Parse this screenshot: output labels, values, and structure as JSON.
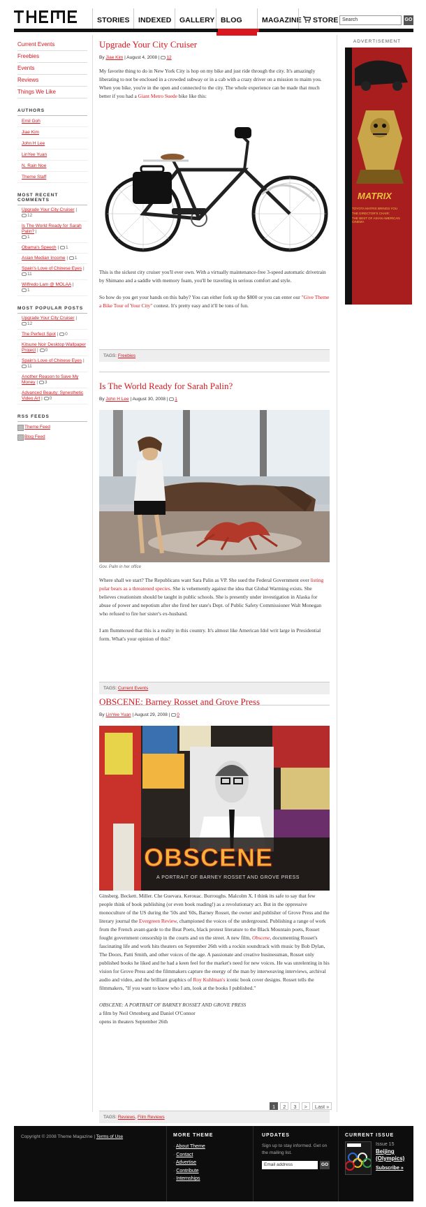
{
  "header": {
    "logo": "THEME",
    "nav": [
      {
        "label": "STORIES"
      },
      {
        "label": "INDEXED"
      },
      {
        "label": "GALLERY"
      },
      {
        "label": "BLOG"
      },
      {
        "label": "MAGAZINE"
      },
      {
        "label": "STORE"
      }
    ],
    "search_value": "Search",
    "go_label": "GO"
  },
  "sidebar": {
    "sections": [
      "Current Events",
      "Freebies",
      "Events",
      "Reviews",
      "Things We Like"
    ],
    "authors_heading": "AUTHORS",
    "authors": [
      "Emil Goh",
      "Jiae Kim",
      "John H Lee",
      "LinYee Yuan",
      "N. Rain Noe",
      "Theme Staff"
    ],
    "recent_heading": "MOST RECENT COMMENTS",
    "recent": [
      {
        "title": "Upgrade Your City Cruiser",
        "count": "12"
      },
      {
        "title": "Is The World Ready for Sarah Palin?",
        "count": "1"
      },
      {
        "title": "Obama's Speech",
        "count": "1"
      },
      {
        "title": "Asian Median Income",
        "count": "1"
      },
      {
        "title": "Spain's Love of Chinese Eyes",
        "count": "11"
      },
      {
        "title": "Wilfredo Lam @ MOLAA",
        "count": "1"
      }
    ],
    "popular_heading": "MOST POPULAR POSTS",
    "popular": [
      {
        "title": "Upgrade Your City Cruiser",
        "count": "12"
      },
      {
        "title": "The Perfect Spot",
        "count": "0"
      },
      {
        "title": "Kitsune Noir Desktop Wallpaper Project",
        "count": "0"
      },
      {
        "title": "Spain's Love of Chinese Eyes",
        "count": "11"
      },
      {
        "title": "Another Reason to Save My Money",
        "count": "3"
      },
      {
        "title": "Advanced Beauty: Synesthetic Video Art",
        "count": "0"
      }
    ],
    "rss_heading": "RSS FEEDS",
    "rss": [
      "Theme Feed",
      "Blog Feed"
    ]
  },
  "posts": [
    {
      "title": "Upgrade Your City Cruiser",
      "by": "By",
      "author": "Jiae Kim",
      "date": "August 4, 2008",
      "comments": "12",
      "p1a": "My favorite thing to do in New York City is hop on my bike and just ride through the city. It's amazingly liberating to not be enclosed in a crowded subway or in a cab with a crazy driver on a mission to maim you. When you bike, you're in the open and connected to the city. The whole experience can be made that much better if you had a",
      "p1link": "Giant Metro Suede",
      "p1b": "bike like this:",
      "p2": "This is the sickest city cruiser you'll ever own. With a virtually maintenance-free 3-speed automatic drivetrain by Shimano and a saddle with memory foam, you'll be traveling in serious comfort and style.",
      "p3a": "So how do you get your hands on this baby? You can either fork up the $800 or you can enter our",
      "p3link": "\"Give Theme a Bike Tour of Your City\"",
      "p3b": "contest. It's pretty easy and it'll be tons of fun.",
      "tags_label": "TAGS:",
      "tags": [
        "Freebies"
      ]
    },
    {
      "title": "Is The World Ready for Sarah Palin?",
      "by": "By",
      "author": "John H Lee",
      "date": "August 30, 2008",
      "comments": "1",
      "caption": "Gov. Palin in her office",
      "p1a": "Where shall we start? The Republicans want Sara Palin as VP. She sued the Federal Government over",
      "p1link": "listing polar bears as a threatened species",
      "p1b": ". She is vehemently against the idea that Global Warming exists. She believes creationism should be taught in public schools. She is presently under investigation in Alaska for abuse of power and nepotism after she fired her state's Dept. of Public Safety Commissioner Walt Monegan who refused to fire her sister's ex-husband.",
      "p2": "I am flummoxed that this is a reality in this country. It's almost like American Idol writ large in Presidential form. What's your opinion of this?",
      "tags_label": "TAGS:",
      "tags": [
        "Current Events"
      ]
    },
    {
      "title": "OBSCENE: Barney Rosset and Grove Press",
      "by": "By",
      "author": "LinYee Yuan",
      "date": "August 29, 2008",
      "comments": "0",
      "cover_title": "OBSCENE",
      "cover_sub": "A PORTRAIT OF BARNEY ROSSET AND GROVE PRESS",
      "p1a": "Ginsberg. Beckett. Miller. Che Guevara. Kerouac. Burroughs. Malcolm X. I think its safe to say that few people think of book publishing (or even book reading!) as a revolutionary act. But in the oppressive monoculture of the US during the '50s and '60s, Barney Rosset, the owner and publisher of Grove Press and the literary journal the",
      "p1link": "Evergreen Review",
      "p1b": ", championed the voices of the underground. Publishing a range of work from the French avant-garde to the Beat Poets, black protest literature to the Black Mountain poets, Rosset fought government censorship in the courts and on the street. A new film,",
      "p1link2": "Obscene",
      "p1c": ", documenting Rosset's fascinating life and work hits theaters on September 26th with a rockin soundtrack with music by Bob Dylan, The Doors, Patti Smith, and other voices of the age. A passionate and creative businessman, Rosset only published books he liked and he had a keen feel for the market's need for new voices. He was unrelenting in his vision for Grove Press and the filmmakers capture the energy of the man by interweaving interviews, archival audio and video, and the brilliant graphics of",
      "p1link3": "Roy Kuhlman's",
      "p1d": "iconic book cover designs. Rosset tells the filmmakers, \"If you want to know who I am, look at the books I published.\"",
      "credit1": "OBSCENE: A PORTRAIT OF BARNEY ROSSET AND GROVE PRESS",
      "credit2": "a film by Neil Ortenberg and Daniel O'Connor",
      "credit3": "opens in theaters September 26th",
      "tags_label": "TAGS:",
      "tags": [
        "Reviews",
        "Film Reviews"
      ]
    }
  ],
  "ad": {
    "label": "ADVERTISEMENT",
    "brand": "MATRIX",
    "line1": "TOYOTA MATRIX BRINGS YOU",
    "line2": "THE DIRECTOR'S CHAIR:",
    "line3": "THE BEST OF ASIAN AMERICAN CINEMA"
  },
  "pagination": {
    "pages": [
      "1",
      "2",
      "3"
    ],
    "next": ">",
    "last": "Last »"
  },
  "footer": {
    "copyright": "Copyright © 2008 Theme Magazine |",
    "terms": "Terms of Use",
    "more_heading": "MORE THEME",
    "more_links": [
      "About Theme",
      "Contact",
      "Advertise",
      "Contribute",
      "Internships"
    ],
    "updates_heading": "UPDATES",
    "updates_text": "Sign up to stay informed. Get on the mailing list.",
    "email_placeholder": "Email address",
    "email_go": "GO",
    "issue_heading": "CURRENT ISSUE",
    "issue_num": "Issue 15",
    "issue_title": "Beijing (Olympics)",
    "subscribe": "Subscribe »"
  },
  "colors": {
    "accent": "#d8171e",
    "header_bar": "#111111",
    "footer_bg": "#0d0d0d"
  }
}
